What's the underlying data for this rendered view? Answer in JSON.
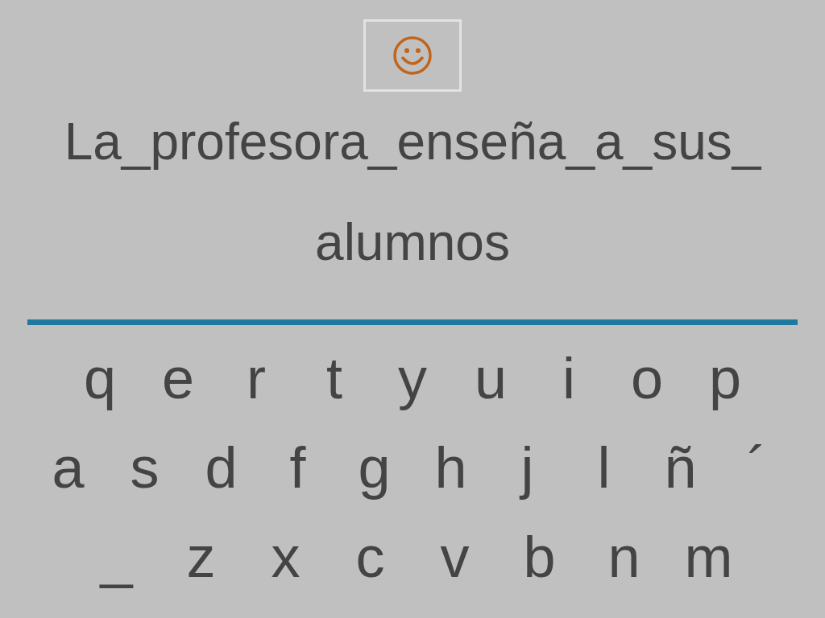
{
  "sentence_lines": [
    "La_profesora_enseña_a_sus_",
    "alumnos"
  ],
  "keyboard_rows": [
    [
      "q",
      "e",
      "r",
      "t",
      "y",
      "u",
      "i",
      "o",
      "p"
    ],
    [
      "a",
      "s",
      "d",
      "f",
      "g",
      "h",
      "j",
      "l",
      "ñ",
      "´"
    ],
    [
      "_",
      "z",
      "x",
      "c",
      "v",
      "b",
      "n",
      "m"
    ]
  ]
}
